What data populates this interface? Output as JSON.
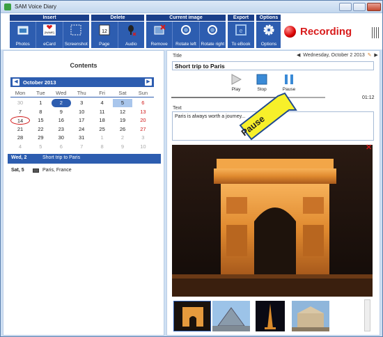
{
  "window": {
    "title": "SAM Voice Diary"
  },
  "toolbar": {
    "groups": [
      {
        "name": "Insert",
        "buttons": [
          "Photos",
          "eCard",
          "Screenshot"
        ]
      },
      {
        "name": "Delete",
        "buttons": [
          "Page",
          "Audio"
        ]
      },
      {
        "name": "Current image",
        "buttons": [
          "Remove",
          "Rotate left",
          "Rotate right"
        ]
      },
      {
        "name": "Export",
        "buttons": [
          "To eBook"
        ]
      },
      {
        "name": "Options",
        "buttons": [
          "Options"
        ]
      }
    ],
    "ecard_badge": "[NAME]",
    "page_badge": "12"
  },
  "recording": {
    "label": "Recording"
  },
  "left": {
    "contents_label": "Contents",
    "calendar": {
      "month": "October 2013",
      "dows": [
        "Mon",
        "Tue",
        "Wed",
        "Thu",
        "Fri",
        "Sat",
        "Sun"
      ],
      "weeks": [
        [
          "30",
          "1",
          "2",
          "3",
          "4",
          "5",
          "6"
        ],
        [
          "7",
          "8",
          "9",
          "10",
          "11",
          "12",
          "13"
        ],
        [
          "14",
          "15",
          "16",
          "17",
          "18",
          "19",
          "20"
        ],
        [
          "21",
          "22",
          "23",
          "24",
          "25",
          "26",
          "27"
        ],
        [
          "28",
          "29",
          "30",
          "31",
          "1",
          "2",
          "3"
        ],
        [
          "4",
          "5",
          "6",
          "7",
          "8",
          "9",
          "10"
        ]
      ],
      "selected_day": "2",
      "circled_day": "14",
      "highlight_sat": "5"
    },
    "entries": [
      {
        "date": "Wed, 2",
        "title": "Short trip to Paris"
      },
      {
        "date": "Sat, 5",
        "title": "Paris, France"
      }
    ]
  },
  "right": {
    "title_label": "Title",
    "date": "Wednesday, October 2 2013",
    "title_value": "Short trip to Paris",
    "controls": [
      "Play",
      "Stop",
      "Pause"
    ],
    "time": "01:12",
    "progress": 0.76,
    "text_label": "Text",
    "text_value": "Paris is always worth a journey...",
    "callout": "Pause"
  },
  "colors": {
    "toolbar_blue": "#2d5db0",
    "header_dark": "#1a3f8a",
    "recording_red": "#d81b1b"
  }
}
